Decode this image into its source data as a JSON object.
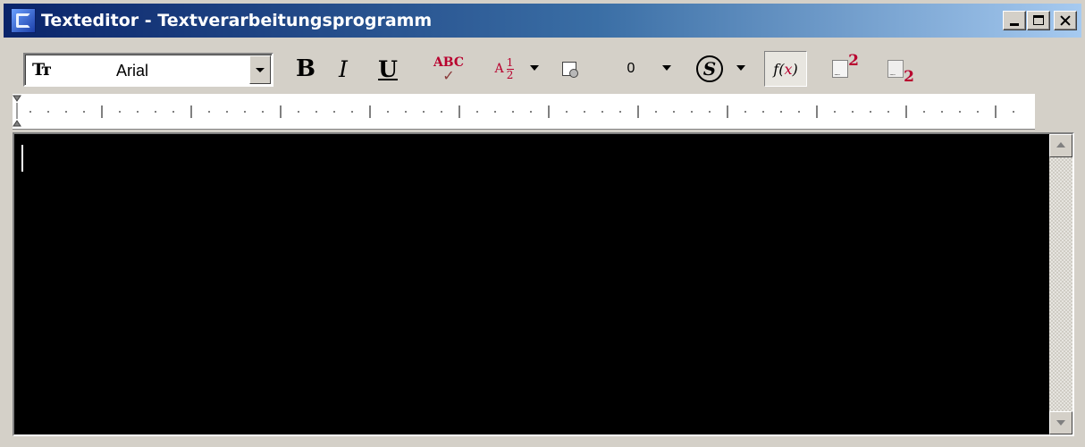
{
  "window": {
    "title": "Texteditor - Textverarbeitungsprogramm",
    "title_bar_colors": [
      "#0a246a",
      "#3a6ea5",
      "#a6caf0"
    ],
    "caption_buttons": [
      "minimize-icon",
      "maximize-icon",
      "close-icon"
    ]
  },
  "toolbar": {
    "font_icon": "Tт",
    "font_name": "Arial",
    "bold_label": "B",
    "italic_label": "I",
    "underline_label": "U",
    "spellcheck_label": "ABC",
    "spellcheck_mark": "✓",
    "fraction_prefix": "A",
    "fraction_numerator": "1",
    "fraction_denominator": "2",
    "number_value": "0",
    "symbol_label": "S",
    "function_prefix": "f(",
    "function_var": "x",
    "function_suffix": ")",
    "superscript_digit": "2",
    "subscript_digit": "2",
    "accent_color": "#b8002e"
  },
  "editor": {
    "background": "#000000",
    "content": ""
  }
}
